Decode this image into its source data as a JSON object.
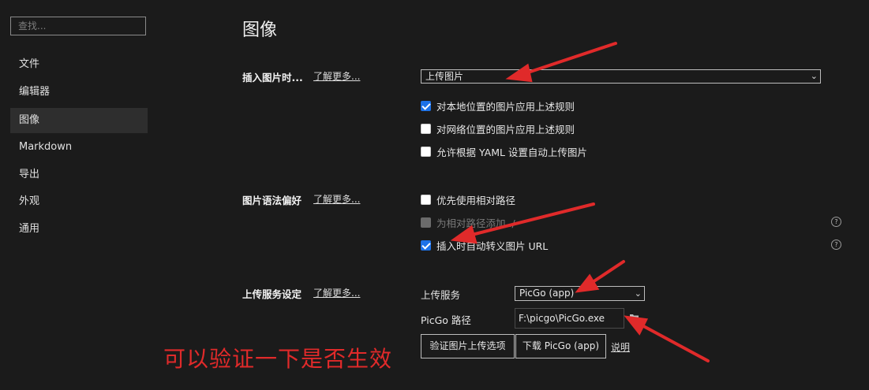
{
  "sidebar": {
    "search_placeholder": "查找...",
    "items": [
      {
        "label": "文件"
      },
      {
        "label": "编辑器"
      },
      {
        "label": "图像",
        "active": true
      },
      {
        "label": "Markdown"
      },
      {
        "label": "导出"
      },
      {
        "label": "外观"
      },
      {
        "label": "通用"
      }
    ]
  },
  "main": {
    "title": "图像",
    "learn_more": "了解更多...",
    "insert_section": {
      "label": "插入图片时...",
      "select_value": "上传图片",
      "options": [
        {
          "label": "对本地位置的图片应用上述规则",
          "checked": true
        },
        {
          "label": "对网络位置的图片应用上述规则",
          "checked": false
        },
        {
          "label": "允许根据 YAML 设置自动上传图片",
          "checked": false
        }
      ]
    },
    "syntax_section": {
      "label": "图片语法偏好",
      "options": [
        {
          "label": "优先使用相对路径",
          "checked": false
        },
        {
          "label": "为相对路径添加 ./",
          "checked": false,
          "disabled": true
        },
        {
          "label": "插入时自动转义图片 URL",
          "checked": true
        }
      ],
      "help_glyph": "?"
    },
    "upload_section": {
      "label": "上传服务设定",
      "service_label": "上传服务",
      "service_value": "PicGo (app)",
      "path_label": "PicGo 路径",
      "path_value": "F:\\picgo\\PicGo.exe",
      "verify_button": "验证图片上传选项",
      "download_button": "下载 PicGo (app)",
      "explain_link": "说明"
    }
  },
  "annotation": {
    "text": "可以验证一下是否生效",
    "color": "#e02a2a"
  },
  "colors": {
    "background": "#1b1b1b",
    "accent": "#1d72e8",
    "active_nav": "#2e2e2e"
  },
  "icons": {
    "dropdown": "chevron-down-icon",
    "folder": "folder-icon",
    "help": "help-circle-icon",
    "check": "check-icon"
  }
}
